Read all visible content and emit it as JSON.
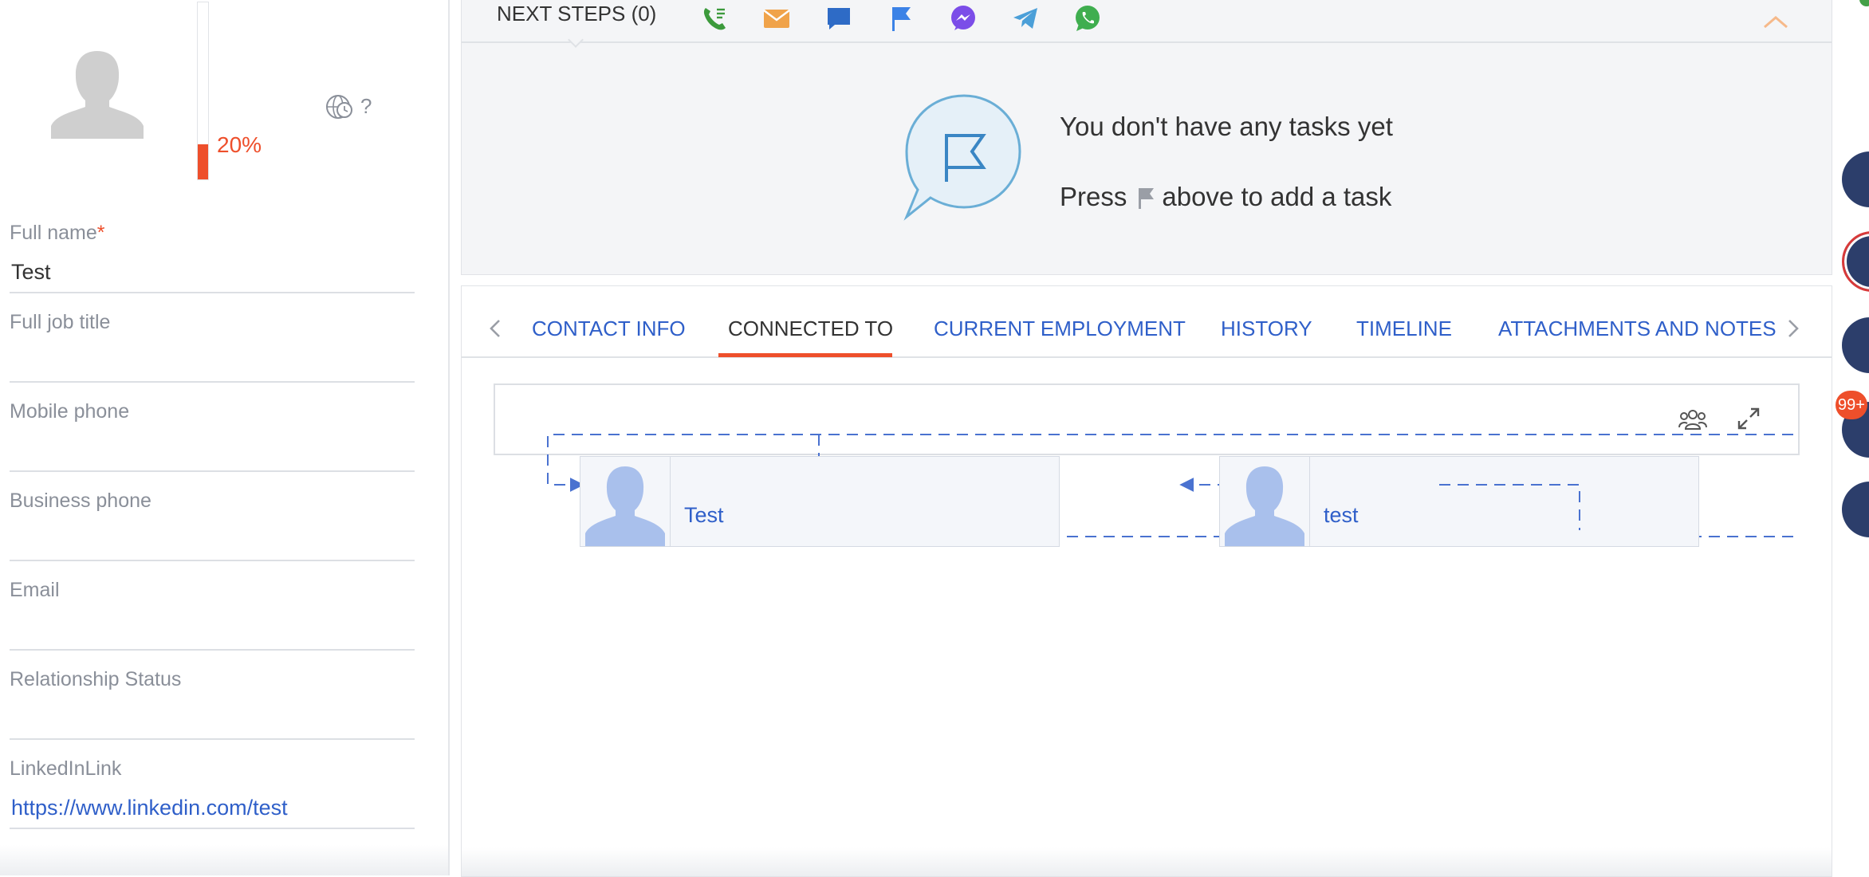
{
  "profile": {
    "completeness": {
      "percent_label": "20%",
      "fraction": 0.2
    },
    "timezone_unknown": "?",
    "fields": [
      {
        "label": "Full name",
        "required_mark": "*",
        "value": "Test"
      },
      {
        "label": "Full job title",
        "value": ""
      },
      {
        "label": "Mobile phone",
        "value": ""
      },
      {
        "label": "Business phone",
        "value": ""
      },
      {
        "label": "Email",
        "value": ""
      },
      {
        "label": "Relationship Status",
        "value": ""
      },
      {
        "label": "LinkedInLink",
        "value": "https://www.linkedin.com/test"
      }
    ]
  },
  "next_steps": {
    "title": "NEXT STEPS (0)",
    "actions": [
      {
        "icon": "phone-icon",
        "color": "#3c9a3c"
      },
      {
        "icon": "email-icon",
        "color": "#f0a34a"
      },
      {
        "icon": "chat-icon",
        "color": "#2e6bc6"
      },
      {
        "icon": "flag-icon",
        "color": "#3b82e6"
      },
      {
        "icon": "messenger-icon",
        "color": "#7b4de8"
      },
      {
        "icon": "telegram-icon",
        "color": "#4b9fd8"
      },
      {
        "icon": "whatsapp-icon",
        "color": "#3fae4f"
      }
    ],
    "empty": {
      "title": "You don't have any tasks yet",
      "hint_before": "Press",
      "hint_after": "above to add a task"
    }
  },
  "tabs": {
    "items": [
      "CONTACT INFO",
      "CONNECTED TO",
      "CURRENT EMPLOYMENT",
      "HISTORY",
      "TIMELINE",
      "ATTACHMENTS AND NOTES"
    ],
    "active": "CONNECTED TO"
  },
  "graph": {
    "nodes": [
      "Test",
      "test"
    ]
  },
  "rail": {
    "badge": "99+"
  },
  "colors": {
    "accent": "#ee4f2b",
    "link": "#2f5fc9",
    "graph_line": "#4a72d0",
    "rail": "#2c3e6b"
  }
}
